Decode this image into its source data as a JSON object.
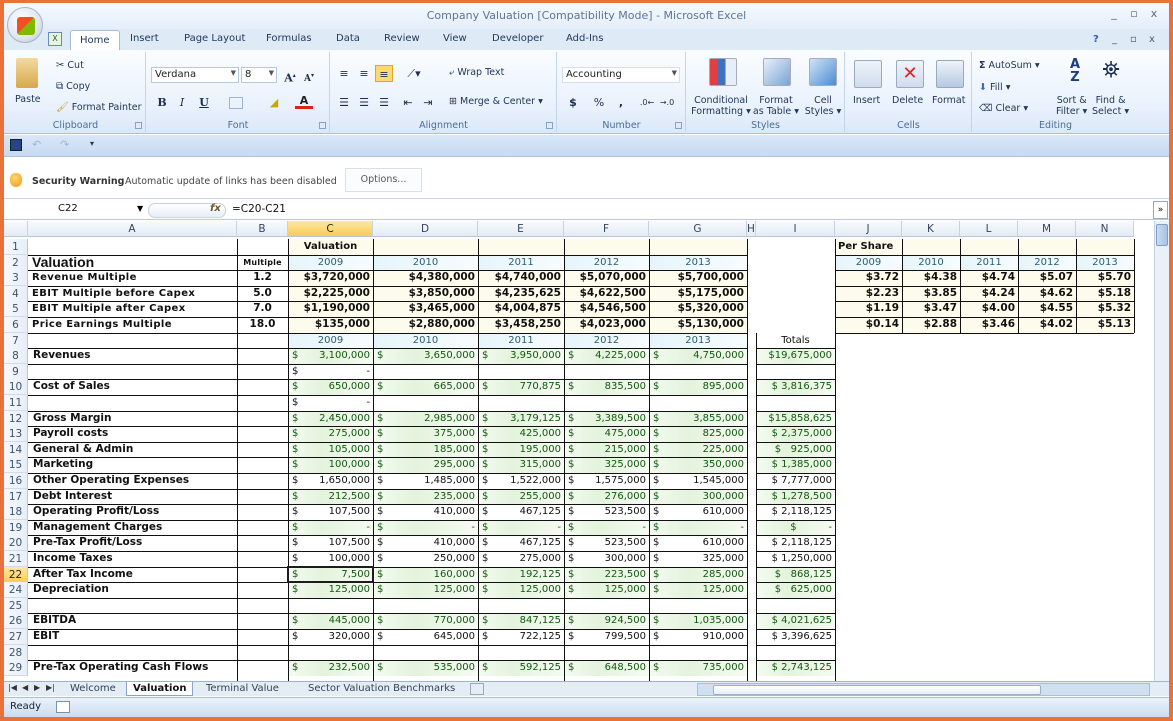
{
  "window": {
    "title": "Company Valuation  [Compatibility Mode] - Microsoft Excel",
    "controls": [
      "_",
      "▫",
      "x"
    ],
    "doc_controls": [
      "?",
      "_",
      "▫",
      "x"
    ]
  },
  "tabs": [
    "Home",
    "Insert",
    "Page Layout",
    "Formulas",
    "Data",
    "Review",
    "View",
    "Developer",
    "Add-Ins"
  ],
  "ribbon": {
    "clipboard": {
      "label": "Clipboard",
      "paste": "Paste",
      "cut": "Cut",
      "copy": "Copy",
      "format_painter": "Format Painter"
    },
    "font": {
      "label": "Font",
      "font_name": "Verdana",
      "font_size": "8",
      "bold": "B",
      "italic": "I",
      "underline": "U"
    },
    "alignment": {
      "label": "Alignment",
      "wrap_text": "Wrap Text",
      "merge_center": "Merge & Center"
    },
    "number": {
      "label": "Number",
      "format": "Accounting",
      "currency": "$",
      "percent": "%",
      "comma": ","
    },
    "styles": {
      "label": "Styles",
      "conditional": "Conditional\nFormatting",
      "cond1": "Conditional",
      "cond2": "Formatting ▾",
      "table1": "Format",
      "table2": "as Table ▾",
      "cell1": "Cell",
      "cell2": "Styles ▾"
    },
    "cells": {
      "label": "Cells",
      "insert": "Insert",
      "delete": "Delete",
      "format": "Format"
    },
    "editing": {
      "label": "Editing",
      "autosum": "AutoSum ▾",
      "fill": "Fill ▾",
      "clear": "Clear ▾",
      "sort1": "Sort &",
      "sort2": "Filter ▾",
      "find1": "Find &",
      "find2": "Select ▾"
    }
  },
  "security": {
    "title": "Security Warning",
    "message": "Automatic update of links has been disabled",
    "options": "Options..."
  },
  "formula_bar": {
    "name_box": "C22",
    "fx": "fx",
    "formula": "=C20-C21"
  },
  "columns": [
    "A",
    "B",
    "C",
    "D",
    "E",
    "F",
    "G",
    "H",
    "I",
    "J",
    "K",
    "L",
    "M",
    "N"
  ],
  "selected_column": "C",
  "selected_row": "22",
  "valuation": {
    "header": "Valuation",
    "title": "Valuation",
    "multiple_label": "Multiple",
    "years": [
      "2009",
      "2010",
      "2011",
      "2012",
      "2013"
    ],
    "rows": [
      {
        "row": "3",
        "label": "Revenue Multiple",
        "multiple": "1.2",
        "values": [
          "$3,720,000",
          "$4,380,000",
          "$4,740,000",
          "$5,070,000",
          "$5,700,000"
        ]
      },
      {
        "row": "4",
        "label": "EBIT Multiple before Capex",
        "multiple": "5.0",
        "values": [
          "$2,225,000",
          "$3,850,000",
          "$4,235,625",
          "$4,622,500",
          "$5,175,000"
        ]
      },
      {
        "row": "5",
        "label": "EBIT Multiple after Capex",
        "multiple": "7.0",
        "values": [
          "$1,190,000",
          "$3,465,000",
          "$4,004,875",
          "$4,546,500",
          "$5,320,000"
        ]
      },
      {
        "row": "6",
        "label": "Price Earnings Multiple",
        "multiple": "18.0",
        "values": [
          "$135,000",
          "$2,880,000",
          "$3,458,250",
          "$4,023,000",
          "$5,130,000"
        ]
      }
    ]
  },
  "per_share": {
    "header": "Per Share",
    "years": [
      "2009",
      "2010",
      "2011",
      "2012",
      "2013"
    ],
    "rows": [
      [
        "$3.72",
        "$4.38",
        "$4.74",
        "$5.07",
        "$5.70"
      ],
      [
        "$2.23",
        "$3.85",
        "$4.24",
        "$4.62",
        "$5.18"
      ],
      [
        "$1.19",
        "$3.47",
        "$4.00",
        "$4.55",
        "$5.32"
      ],
      [
        "$0.14",
        "$2.88",
        "$3.46",
        "$4.02",
        "$5.13"
      ]
    ]
  },
  "financials": {
    "years": [
      "2009",
      "2010",
      "2011",
      "2012",
      "2013"
    ],
    "totals_label": "Totals",
    "rows": [
      {
        "row": "8",
        "label": "Revenues",
        "values": [
          "3,100,000",
          "3,650,000",
          "3,950,000",
          "4,225,000",
          "4,750,000"
        ],
        "total": "$19,675,000",
        "green": true
      },
      {
        "row": "9",
        "label": "",
        "values": [
          "-",
          null,
          null,
          null,
          null
        ],
        "total": null,
        "green": false
      },
      {
        "row": "10",
        "label": "Cost of Sales",
        "values": [
          "650,000",
          "665,000",
          "770,875",
          "835,500",
          "895,000"
        ],
        "total": "$ 3,816,375",
        "green": true
      },
      {
        "row": "11",
        "label": "",
        "values": [
          "-",
          null,
          null,
          null,
          null
        ],
        "total": null,
        "green": false
      },
      {
        "row": "12",
        "label": "Gross Margin",
        "values": [
          "2,450,000",
          "2,985,000",
          "3,179,125",
          "3,389,500",
          "3,855,000"
        ],
        "total": "$15,858,625",
        "green": true
      },
      {
        "row": "13",
        "label": "Payroll costs",
        "values": [
          "275,000",
          "375,000",
          "425,000",
          "475,000",
          "825,000"
        ],
        "total": "$ 2,375,000",
        "green": true
      },
      {
        "row": "14",
        "label": "General & Admin",
        "values": [
          "105,000",
          "185,000",
          "195,000",
          "215,000",
          "225,000"
        ],
        "total": "$   925,000",
        "green": true
      },
      {
        "row": "15",
        "label": "Marketing",
        "values": [
          "100,000",
          "295,000",
          "315,000",
          "325,000",
          "350,000"
        ],
        "total": "$ 1,385,000",
        "green": true
      },
      {
        "row": "16",
        "label": "Other Operating Expenses",
        "values": [
          "1,650,000",
          "1,485,000",
          "1,522,000",
          "1,575,000",
          "1,545,000"
        ],
        "total": "$ 7,777,000",
        "green": false
      },
      {
        "row": "17",
        "label": "Debt Interest",
        "values": [
          "212,500",
          "235,000",
          "255,000",
          "276,000",
          "300,000"
        ],
        "total": "$ 1,278,500",
        "green": true
      },
      {
        "row": "18",
        "label": "Operating Profit/Loss",
        "values": [
          "107,500",
          "410,000",
          "467,125",
          "523,500",
          "610,000"
        ],
        "total": "$ 2,118,125",
        "green": false
      },
      {
        "row": "19",
        "label": "Management Charges",
        "values": [
          "-",
          "-",
          "-",
          "-",
          "-"
        ],
        "total": "$          -",
        "green": true
      },
      {
        "row": "20",
        "label": "Pre-Tax Profit/Loss",
        "values": [
          "107,500",
          "410,000",
          "467,125",
          "523,500",
          "610,000"
        ],
        "total": "$ 2,118,125",
        "green": false
      },
      {
        "row": "21",
        "label": "Income Taxes",
        "values": [
          "100,000",
          "250,000",
          "275,000",
          "300,000",
          "325,000"
        ],
        "total": "$ 1,250,000",
        "green": false
      },
      {
        "row": "22",
        "label": "After Tax Income",
        "values": [
          "7,500",
          "160,000",
          "192,125",
          "223,500",
          "285,000"
        ],
        "total": "$   868,125",
        "green": true
      },
      {
        "row": "24",
        "label": "Depreciation",
        "values": [
          "125,000",
          "125,000",
          "125,000",
          "125,000",
          "125,000"
        ],
        "total": "$   625,000",
        "green": true
      },
      {
        "row": "25",
        "label": "",
        "values": [
          null,
          null,
          null,
          null,
          null
        ],
        "total": null,
        "green": false
      },
      {
        "row": "26",
        "label": "EBITDA",
        "values": [
          "445,000",
          "770,000",
          "847,125",
          "924,500",
          "1,035,000"
        ],
        "total": "$ 4,021,625",
        "green": true
      },
      {
        "row": "27",
        "label": "EBIT",
        "values": [
          "320,000",
          "645,000",
          "722,125",
          "799,500",
          "910,000"
        ],
        "total": "$ 3,396,625",
        "green": false
      },
      {
        "row": "28",
        "label": "",
        "values": [
          null,
          null,
          null,
          null,
          null
        ],
        "total": null,
        "green": false
      },
      {
        "row": "29",
        "label": "Pre-Tax Operating Cash Flows",
        "values": [
          "232,500",
          "535,000",
          "592,125",
          "648,500",
          "735,000"
        ],
        "total": "$ 2,743,125",
        "green": true
      }
    ]
  },
  "sheet_tabs": [
    "Welcome",
    "Valuation",
    "Terminal Value",
    "Sector Valuation Benchmarks"
  ],
  "active_sheet": "Valuation",
  "status": "Ready"
}
